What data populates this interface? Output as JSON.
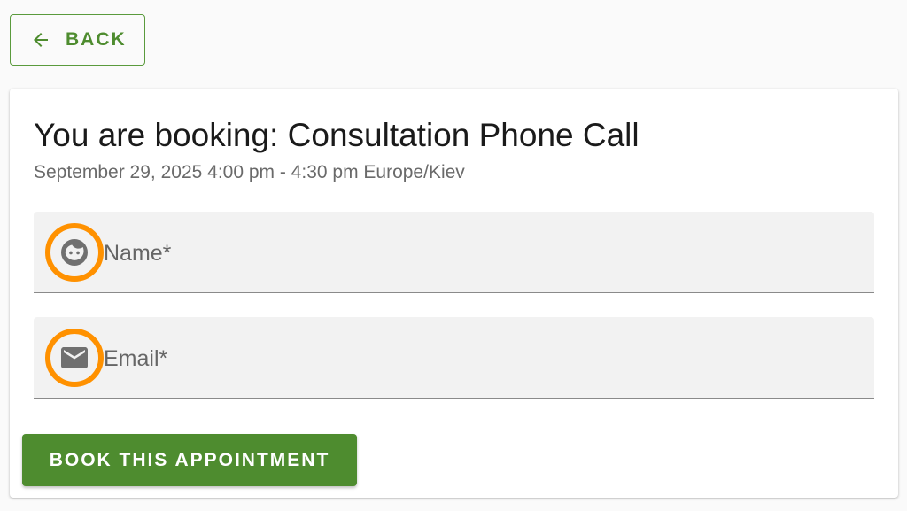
{
  "back_button": {
    "label": "BACK",
    "icon": "arrow-left-icon"
  },
  "booking": {
    "title": "You are booking: Consultation Phone Call",
    "subtitle": "September 29, 2025 4:00 pm - 4:30 pm Europe/Kiev"
  },
  "form": {
    "name_field": {
      "label": "Name*",
      "icon": "face-icon",
      "value": ""
    },
    "email_field": {
      "label": "Email*",
      "icon": "mail-icon",
      "value": ""
    }
  },
  "actions": {
    "book_label": "BOOK THIS APPOINTMENT"
  },
  "colors": {
    "accent": "#4e8c2f",
    "highlight_ring": "#ff9100",
    "field_bg": "#f2f2f2",
    "icon": "#707070"
  }
}
